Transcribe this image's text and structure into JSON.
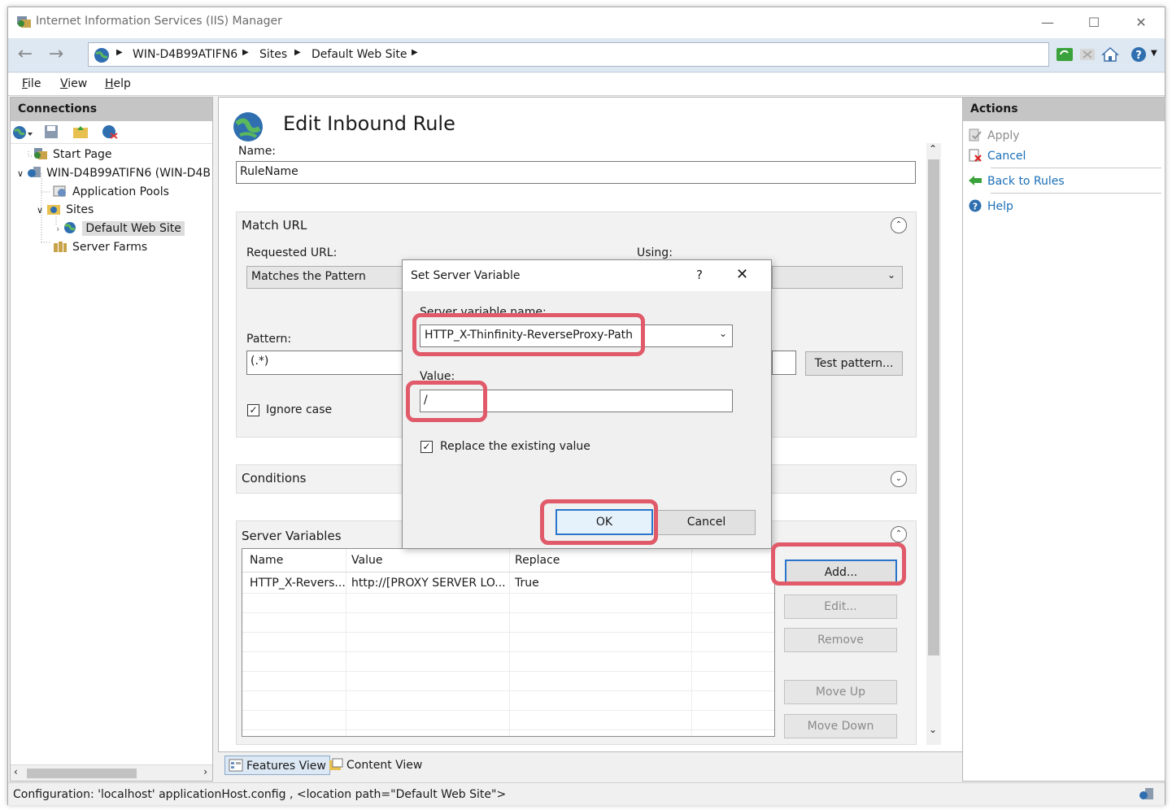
{
  "window": {
    "title": "Internet Information Services (IIS) Manager",
    "controls": {
      "minimize": "—",
      "maximize": "☐",
      "close": "✕"
    }
  },
  "nav": {
    "back": "←",
    "forward": "→",
    "breadcrumb": [
      "WIN-D4B99ATIFN6",
      "Sites",
      "Default Web Site"
    ]
  },
  "menu": [
    "File",
    "View",
    "Help"
  ],
  "connections": {
    "header": "Connections",
    "tree": [
      {
        "label": "Start Page"
      },
      {
        "label": "WIN-D4B99ATIFN6 (WIN-D4B"
      },
      {
        "label": "Application Pools"
      },
      {
        "label": "Sites"
      },
      {
        "label": "Default Web Site"
      },
      {
        "label": "Server Farms"
      }
    ]
  },
  "main": {
    "title": "Edit Inbound Rule",
    "name_label": "Name:",
    "name_value": "RuleName",
    "match_url": {
      "header": "Match URL",
      "requested_url_label": "Requested URL:",
      "requested_url_value": "Matches the Pattern",
      "using_label": "Using:",
      "pattern_label": "Pattern:",
      "pattern_value": "(.*)",
      "test_pattern_button": "Test pattern...",
      "ignore_case_label": "Ignore case"
    },
    "conditions": {
      "header": "Conditions"
    },
    "server_variables": {
      "header": "Server Variables",
      "columns": [
        "Name",
        "Value",
        "Replace"
      ],
      "rows": [
        [
          "HTTP_X-Revers...",
          "http://[PROXY SERVER LO...",
          "True"
        ]
      ],
      "buttons": {
        "add": "Add...",
        "edit": "Edit...",
        "remove": "Remove",
        "move_up": "Move Up",
        "move_down": "Move Down"
      }
    }
  },
  "actions": {
    "header": "Actions",
    "items": {
      "apply": "Apply",
      "cancel": "Cancel",
      "back_to_rules": "Back to Rules",
      "help": "Help"
    }
  },
  "view_tabs": {
    "features": "Features View",
    "content": "Content View"
  },
  "status": {
    "text": "Configuration: 'localhost' applicationHost.config , <location path=\"Default Web Site\">"
  },
  "dialog": {
    "title": "Set Server Variable",
    "help": "?",
    "close": "✕",
    "variable_name_label": "Server variable name:",
    "variable_name_value": "HTTP_X-Thinfinity-ReverseProxy-Path",
    "value_label": "Value:",
    "value_value": "/",
    "replace_label": "Replace the existing value",
    "ok": "OK",
    "cancel": "Cancel"
  },
  "colors": {
    "highlight": "#e05a6a",
    "link": "#1a6fb7",
    "navbar": "#dde8f3"
  }
}
